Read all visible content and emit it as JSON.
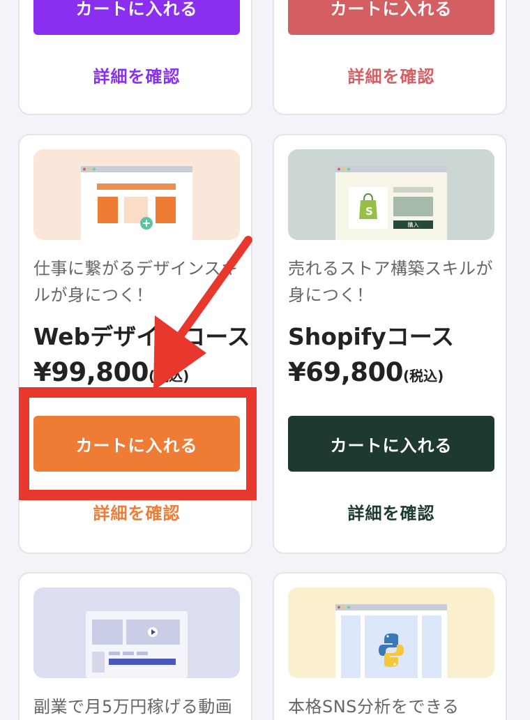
{
  "colors": {
    "purple": "#8a2ff0",
    "rose": "#d45f62",
    "orange": "#ef7c35",
    "dark_green": "#1e3a2f",
    "annotation_red": "#e8382d"
  },
  "cards": [
    {
      "id": "top-left",
      "cart_label": "カートに入れる",
      "detail_label": "詳細を確認"
    },
    {
      "id": "top-right",
      "cart_label": "カートに入れる",
      "detail_label": "詳細を確認"
    },
    {
      "id": "web-design",
      "tagline_line1": "仕事に繋がるデザインス",
      "tagline_line1_tail": "キ",
      "tagline_line2": "ルが身につく！",
      "title": "Webデザインコース",
      "price": "¥99,800",
      "tax": "(税込)",
      "cart_label": "カートに入れる",
      "detail_label": "詳細を確認",
      "icon": "web-layout-icon"
    },
    {
      "id": "shopify",
      "tagline_line1": "売れるストア構築スキルが",
      "tagline_line2": "身につく！",
      "title": "Shopifyコース",
      "price": "¥69,800",
      "tax": "(税込)",
      "cart_label": "カートに入れる",
      "detail_label": "詳細を確認",
      "icon": "shopify-bag-icon",
      "mock_button_label": "購入"
    },
    {
      "id": "video",
      "tagline_line1": "副業で月5万円稼げる動画",
      "icon": "video-player-icon"
    },
    {
      "id": "sns",
      "tagline_line1": "本格SNS分析をできる",
      "icon": "python-logo-icon"
    }
  ]
}
